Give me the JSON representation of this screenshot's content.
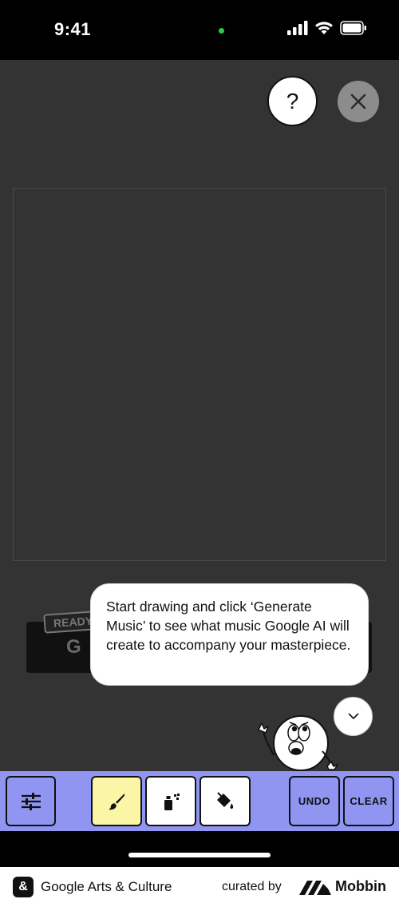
{
  "status_bar": {
    "time": "9:41",
    "indicator_color": "#2ecc40",
    "icons": [
      "signal-icon",
      "wifi-icon",
      "battery-icon"
    ]
  },
  "header": {
    "help_label": "?",
    "close_icon": "close-icon"
  },
  "generate": {
    "badge": "READY",
    "label": "G"
  },
  "tooltip": {
    "text": "Start drawing and click ‘Generate Music’ to see what music Google AI will create to accompany your masterpiece."
  },
  "collapse_icon": "chevron-down-icon",
  "toolbar": {
    "background": "#8f95f0",
    "selected_tool": "brush",
    "selected_color": "#faf6a6",
    "tools": [
      {
        "name": "settings",
        "icon": "sliders-icon"
      },
      {
        "name": "brush",
        "icon": "brush-icon"
      },
      {
        "name": "spray",
        "icon": "spray-can-icon"
      },
      {
        "name": "fill",
        "icon": "paint-bucket-icon"
      }
    ],
    "undo_label": "UNDO",
    "clear_label": "CLEAR"
  },
  "footer": {
    "logo": "&",
    "app_name": "Google Arts & Culture",
    "curated_by": "curated by",
    "brand": "Mobbin"
  }
}
